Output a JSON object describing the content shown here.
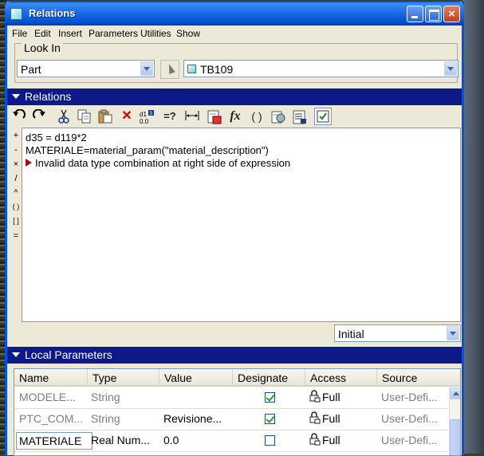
{
  "window": {
    "title": "Relations"
  },
  "menu": [
    "File",
    "Edit",
    "Insert",
    "Parameters",
    "Utilities",
    "Show"
  ],
  "look_in": {
    "label": "Look In",
    "type_value": "Part",
    "model_value": "TB109"
  },
  "relations": {
    "header": "Relations",
    "toolbar_icons": [
      "undo-icon",
      "redo-icon",
      "cut-icon",
      "copy-icon",
      "paste-icon",
      "delete-icon",
      "show-dimension-icon",
      "evaluate-icon",
      "units-icon",
      "insert-parameter-icon",
      "function-icon",
      "parentheses-icon",
      "sort-icon",
      "display-icon",
      "verify-icon"
    ],
    "tool_text": {
      "evaluate": "=?",
      "function": "fx",
      "parentheses": "( )"
    },
    "operators": [
      "+",
      "-",
      "×",
      "/",
      "^",
      "( )",
      "[ ]",
      "="
    ],
    "lines": [
      "d35 = d119*2",
      "MATERIALE=material_param(\"material_description\")"
    ],
    "error_message": "Invalid data type combination at right side of expression",
    "sort_value": "Initial"
  },
  "local_parameters": {
    "header": "Local Parameters",
    "columns": [
      "Name",
      "Type",
      "Value",
      "Designate",
      "Access",
      "Source"
    ],
    "rows": [
      {
        "name": "MODELE...",
        "type": "String",
        "value": "",
        "designate": true,
        "access": "Full",
        "source": "User-Defi..."
      },
      {
        "name": "PTC_COM...",
        "type": "String",
        "value": "Revisione...",
        "designate": true,
        "access": "Full",
        "source": "User-Defi..."
      },
      {
        "name": "MATERIALE",
        "type": "Real Num...",
        "value": "0.0",
        "designate": false,
        "access": "Full",
        "source": "User-Defi..."
      }
    ]
  }
}
